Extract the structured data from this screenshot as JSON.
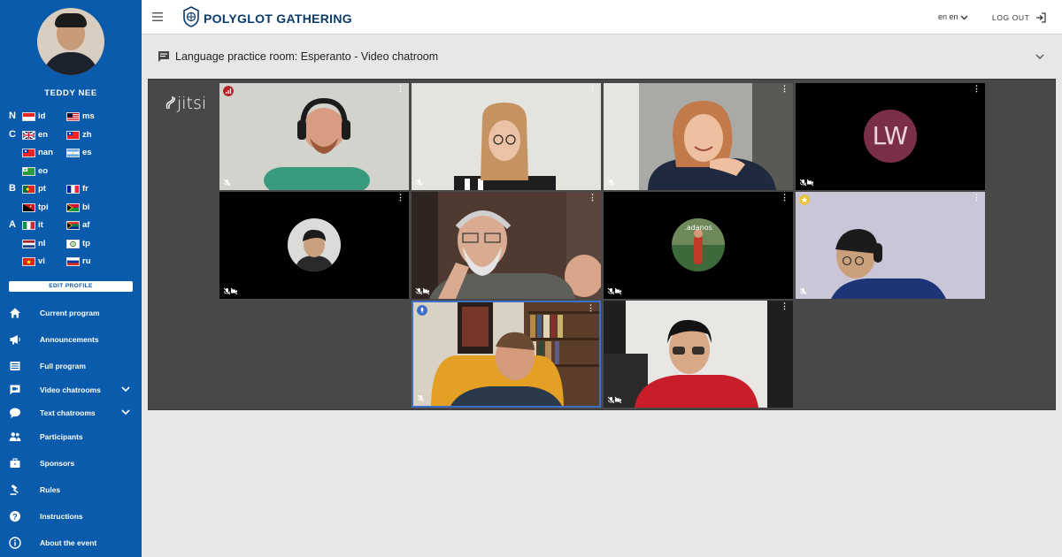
{
  "user": {
    "name": "TEDDY NEE"
  },
  "languages": [
    {
      "level": "N",
      "items": [
        {
          "code": "id",
          "flag": "indonesia"
        },
        {
          "code": "ms",
          "flag": "malaysia"
        }
      ]
    },
    {
      "level": "C",
      "items": [
        {
          "code": "en",
          "flag": "uk"
        },
        {
          "code": "zh",
          "flag": "taiwan"
        }
      ]
    },
    {
      "level": "",
      "items": [
        {
          "code": "nan",
          "flag": "taiwan"
        },
        {
          "code": "es",
          "flag": "argentina"
        }
      ]
    },
    {
      "level": "",
      "items": [
        {
          "code": "eo",
          "flag": "esperanto"
        }
      ]
    },
    {
      "level": "B",
      "items": [
        {
          "code": "pt",
          "flag": "portugal"
        },
        {
          "code": "fr",
          "flag": "france"
        }
      ]
    },
    {
      "level": "",
      "items": [
        {
          "code": "tpi",
          "flag": "papua-new-guinea"
        },
        {
          "code": "bi",
          "flag": "vanuatu"
        }
      ]
    },
    {
      "level": "A",
      "items": [
        {
          "code": "it",
          "flag": "italy"
        },
        {
          "code": "af",
          "flag": "south-africa"
        }
      ]
    },
    {
      "level": "",
      "items": [
        {
          "code": "nl",
          "flag": "netherlands"
        },
        {
          "code": "tp",
          "flag": "toki-pona"
        }
      ]
    },
    {
      "level": "",
      "items": [
        {
          "code": "vi",
          "flag": "vietnam"
        },
        {
          "code": "ru",
          "flag": "russia"
        }
      ]
    }
  ],
  "sidebar": {
    "edit_profile": "EDIT PROFILE",
    "nav": [
      {
        "label": "Current program",
        "icon": "home-icon"
      },
      {
        "label": "Announcements",
        "icon": "megaphone-icon"
      },
      {
        "label": "Full program",
        "icon": "list-icon"
      },
      {
        "label": "Video chatrooms",
        "icon": "video-chat-icon",
        "expandable": true
      },
      {
        "label": "Text chatrooms",
        "icon": "chat-bubble-icon",
        "expandable": true
      },
      {
        "label": "Participants",
        "icon": "people-icon"
      },
      {
        "label": "Sponsors",
        "icon": "briefcase-icon"
      },
      {
        "label": "Rules",
        "icon": "gavel-icon"
      },
      {
        "label": "Instructions",
        "icon": "help-icon"
      },
      {
        "label": "About the event",
        "icon": "info-icon"
      }
    ]
  },
  "header": {
    "brand": "POLYGLOT GATHERING",
    "language": "en en",
    "logout": "LOG OUT"
  },
  "room": {
    "title": "Language practice room: Esperanto - Video chatroom"
  },
  "jitsi": {
    "logo": "jitsi"
  },
  "participants": [
    {
      "kind": "video",
      "scene": "headphones-man",
      "badge": "signal"
    },
    {
      "kind": "video",
      "scene": "glasses-woman"
    },
    {
      "kind": "video",
      "scene": "smiling-woman"
    },
    {
      "kind": "initials",
      "initials": "LW"
    },
    {
      "kind": "avatar",
      "scene": "avatar-man"
    },
    {
      "kind": "video",
      "scene": "bearded-man"
    },
    {
      "kind": "avatar",
      "scene": "avatar-performer",
      "avatar_text": ".adanos"
    },
    {
      "kind": "video",
      "scene": "man-ponytail",
      "badge": "star"
    },
    {
      "kind": "video",
      "scene": "man-bookshelf",
      "active": true,
      "badge": "dominant"
    },
    {
      "kind": "video",
      "scene": "man-glasses-red"
    }
  ],
  "colors": {
    "sidebar": "#0a5bab",
    "brand": "#0a3b6a",
    "video_bg": "#484848",
    "initials_bg": "#7b2f46",
    "active_border": "#3d6fc7"
  }
}
